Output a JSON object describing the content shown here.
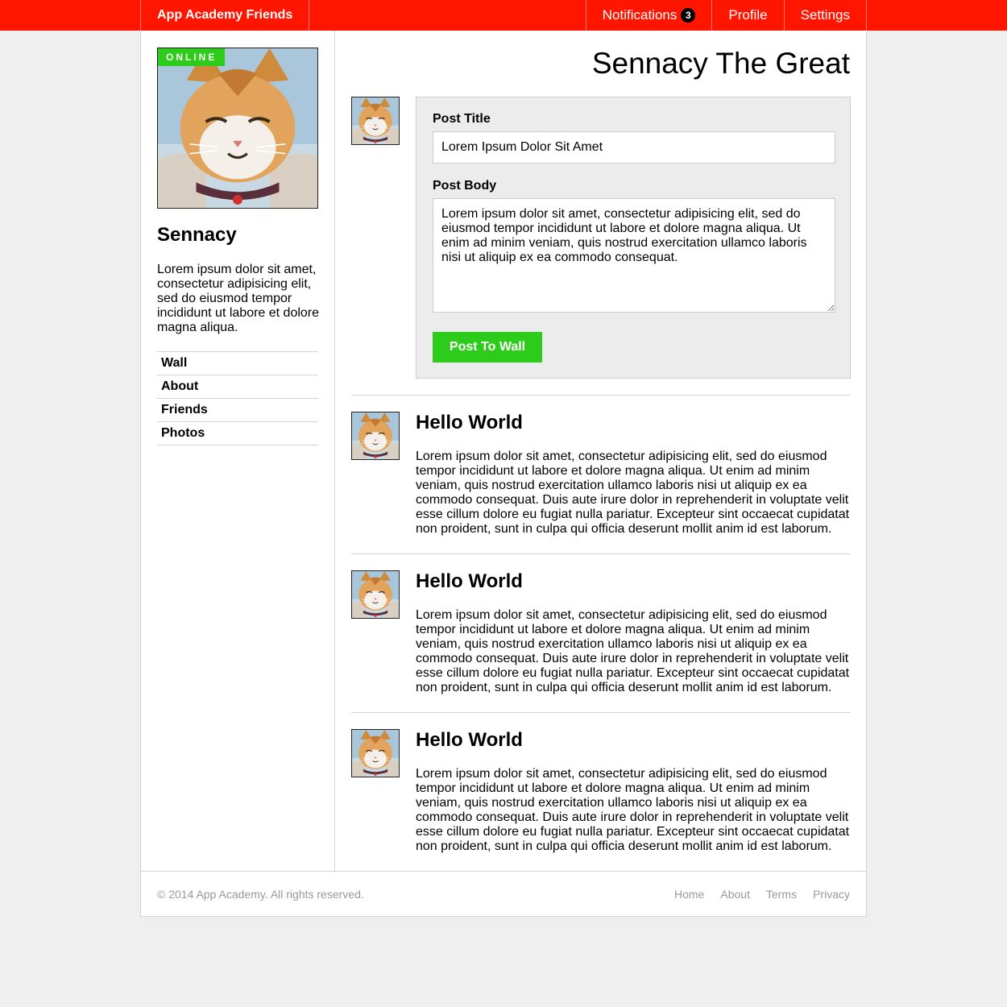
{
  "header": {
    "brand": "App Academy Friends",
    "nav": [
      {
        "label": "Notifications",
        "badge": "3"
      },
      {
        "label": "Profile"
      },
      {
        "label": "Settings"
      }
    ]
  },
  "sidebar": {
    "status": "ONLINE",
    "name": "Sennacy",
    "bio": "Lorem ipsum dolor sit amet, consectetur adipisicing elit, sed do eiusmod tempor incididunt ut labore et dolore magna aliqua.",
    "nav": [
      "Wall",
      "About",
      "Friends",
      "Photos"
    ]
  },
  "main": {
    "title": "Sennacy The Great",
    "form": {
      "title_label": "Post Title",
      "title_value": "Lorem Ipsum Dolor Sit Amet",
      "body_label": "Post Body",
      "body_value": "Lorem ipsum dolor sit amet, consectetur adipisicing elit, sed do eiusmod tempor incididunt ut labore et dolore magna aliqua. Ut enim ad minim veniam, quis nostrud exercitation ullamco laboris nisi ut aliquip ex ea commodo consequat.",
      "submit_label": "Post To Wall"
    },
    "posts": [
      {
        "title": "Hello World",
        "body": "Lorem ipsum dolor sit amet, consectetur adipisicing elit, sed do eiusmod tempor incididunt ut labore et dolore magna aliqua. Ut enim ad minim veniam, quis nostrud exercitation ullamco laboris nisi ut aliquip ex ea commodo consequat. Duis aute irure dolor in reprehenderit in voluptate velit esse cillum dolore eu fugiat nulla pariatur. Excepteur sint occaecat cupidatat non proident, sunt in culpa qui officia deserunt mollit anim id est laborum."
      },
      {
        "title": "Hello World",
        "body": "Lorem ipsum dolor sit amet, consectetur adipisicing elit, sed do eiusmod tempor incididunt ut labore et dolore magna aliqua. Ut enim ad minim veniam, quis nostrud exercitation ullamco laboris nisi ut aliquip ex ea commodo consequat. Duis aute irure dolor in reprehenderit in voluptate velit esse cillum dolore eu fugiat nulla pariatur. Excepteur sint occaecat cupidatat non proident, sunt in culpa qui officia deserunt mollit anim id est laborum."
      },
      {
        "title": "Hello World",
        "body": "Lorem ipsum dolor sit amet, consectetur adipisicing elit, sed do eiusmod tempor incididunt ut labore et dolore magna aliqua. Ut enim ad minim veniam, quis nostrud exercitation ullamco laboris nisi ut aliquip ex ea commodo consequat. Duis aute irure dolor in reprehenderit in voluptate velit esse cillum dolore eu fugiat nulla pariatur. Excepteur sint occaecat cupidatat non proident, sunt in culpa qui officia deserunt mollit anim id est laborum."
      }
    ]
  },
  "footer": {
    "copyright": "© 2014 App Academy. All rights reserved.",
    "links": [
      "Home",
      "About",
      "Terms",
      "Privacy"
    ]
  },
  "colors": {
    "header_bg": "#ff1500",
    "accent_green": "#2ecc1a",
    "page_bg": "#efefef"
  }
}
